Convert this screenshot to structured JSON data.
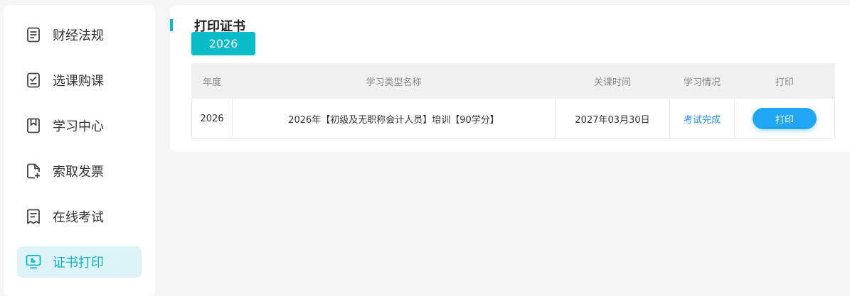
{
  "sidebar": {
    "items": [
      {
        "label": "财经法规",
        "icon": "document-list-icon"
      },
      {
        "label": "选课购课",
        "icon": "checkbox-doc-icon"
      },
      {
        "label": "学习中心",
        "icon": "bookmark-icon"
      },
      {
        "label": "索取发票",
        "icon": "file-add-icon"
      },
      {
        "label": "在线考试",
        "icon": "exam-paper-icon"
      },
      {
        "label": "证书打印",
        "icon": "monitor-icon",
        "active": true
      }
    ]
  },
  "main": {
    "title": "打印证书",
    "year_tab": "2026",
    "table": {
      "headers": [
        "年度",
        "学习类型名称",
        "关课时间",
        "学习情况",
        "打印"
      ],
      "rows": [
        {
          "year": "2026",
          "name": "2026年【初级及无职称会计人员】培训【90学分】",
          "close_time": "2027年03月30日",
          "status": "考试完成",
          "action": "打印"
        }
      ]
    }
  },
  "colors": {
    "accent": "#0abcc8",
    "active_bg": "#def3f8",
    "link": "#2b8fd6",
    "button": "#21a6f3"
  }
}
